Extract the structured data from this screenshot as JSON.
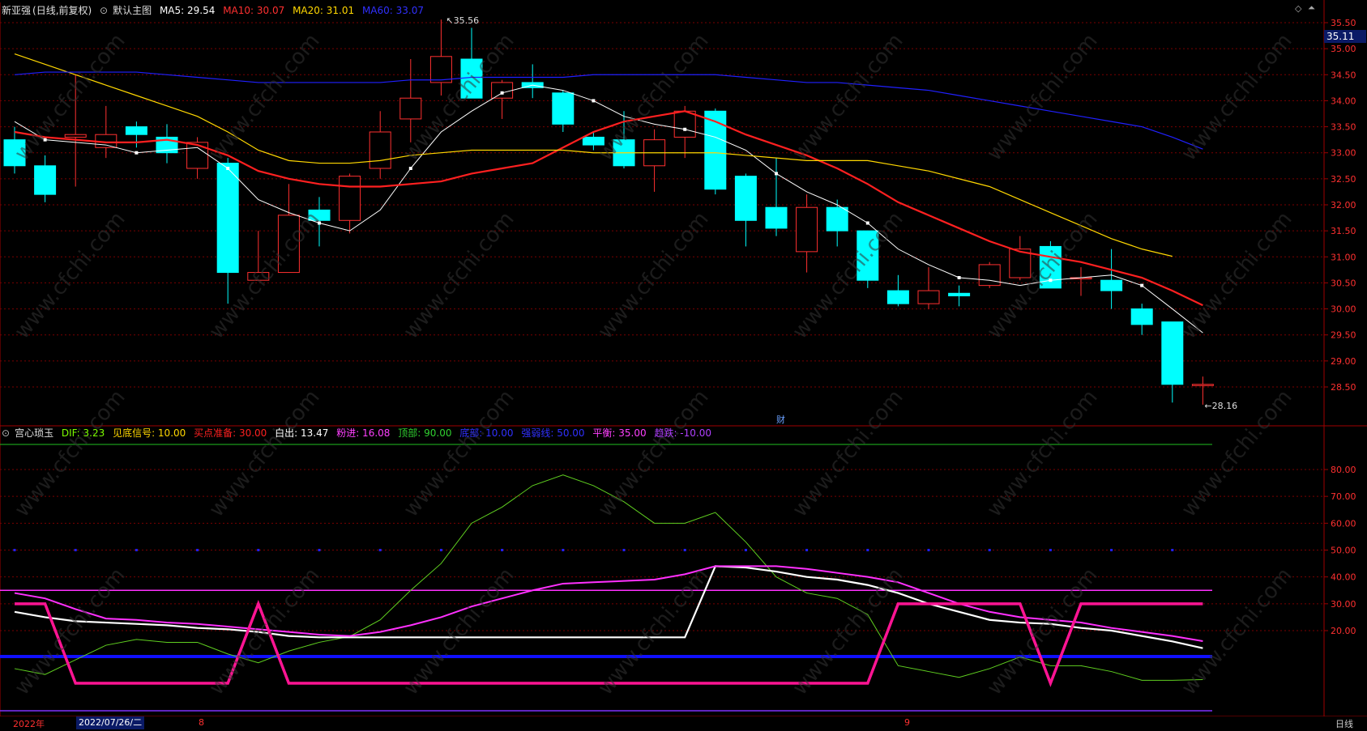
{
  "main_header": {
    "stock_name": "新亚强",
    "mode": "(日线,前复权)",
    "view_label": "默认主图",
    "ma5": "MA5: 29.54",
    "ma10": "MA10: 30.07",
    "ma20": "MA20: 31.01",
    "ma60": "MA60: 33.07"
  },
  "sub_header": {
    "indicator": "宫心琐玉",
    "dif": "DIF: 3.23",
    "signal": "见底信号: 10.00",
    "buy_prep": "买点准备: 30.00",
    "white_out": "白出: 13.47",
    "pink_in": "粉进: 16.08",
    "top": "顶部: 90.00",
    "bottom": "底部: 10.00",
    "strong_weak": "强弱线: 50.00",
    "balance": "平衡: 35.00",
    "fall": "趋跌: -10.00"
  },
  "price_axis_labels": [
    "35.50",
    "35.00",
    "34.50",
    "34.00",
    "33.50",
    "33.00",
    "32.50",
    "32.00",
    "31.50",
    "31.00",
    "30.50",
    "30.00",
    "29.50",
    "29.00",
    "28.50"
  ],
  "current_price_tag": "35.11",
  "sub_axis_labels": [
    "80.00",
    "70.00",
    "60.00",
    "50.00",
    "40.00",
    "30.00",
    "20.00"
  ],
  "high_label": "35.56",
  "low_label": "28.16",
  "finance_marker": "财",
  "date_bar": {
    "year": "2022年",
    "cursor_date": "2022/07/26/二",
    "month_aug": "8",
    "month_sep": "9",
    "period": "日线"
  },
  "colors": {
    "up": "#ff3030",
    "down": "#00ffff",
    "ma5": "#ffffff",
    "ma10": "#ff2020",
    "ma20": "#ffd700",
    "ma60": "#2020ff",
    "grid": "#7a0000"
  },
  "chart_data": [
    {
      "type": "candlestick",
      "title": "新亚强 (日线,前复权)",
      "ylim": [
        28.0,
        35.6
      ],
      "candles": [
        {
          "o": 33.25,
          "c": 32.75,
          "h": 33.5,
          "l": 32.6
        },
        {
          "o": 32.75,
          "c": 32.2,
          "h": 32.95,
          "l": 32.05
        },
        {
          "o": 33.3,
          "c": 33.35,
          "h": 34.5,
          "l": 32.35
        },
        {
          "o": 33.1,
          "c": 33.35,
          "h": 33.9,
          "l": 32.9
        },
        {
          "o": 33.5,
          "c": 33.35,
          "h": 33.6,
          "l": 33.1
        },
        {
          "o": 33.3,
          "c": 33.0,
          "h": 33.55,
          "l": 32.8
        },
        {
          "o": 32.7,
          "c": 33.2,
          "h": 33.3,
          "l": 32.5
        },
        {
          "o": 32.8,
          "c": 30.7,
          "h": 32.9,
          "l": 30.1
        },
        {
          "o": 30.55,
          "c": 30.7,
          "h": 31.5,
          "l": 30.55
        },
        {
          "o": 30.7,
          "c": 31.8,
          "h": 32.4,
          "l": 30.7
        },
        {
          "o": 31.9,
          "c": 31.7,
          "h": 32.15,
          "l": 31.2
        },
        {
          "o": 31.7,
          "c": 32.55,
          "h": 32.6,
          "l": 31.45
        },
        {
          "o": 32.7,
          "c": 33.4,
          "h": 33.8,
          "l": 32.5
        },
        {
          "o": 33.65,
          "c": 34.05,
          "h": 34.8,
          "l": 33.2
        },
        {
          "o": 34.35,
          "c": 34.85,
          "h": 35.56,
          "l": 34.1
        },
        {
          "o": 34.8,
          "c": 34.05,
          "h": 35.4,
          "l": 34.05
        },
        {
          "o": 34.05,
          "c": 34.35,
          "h": 34.4,
          "l": 33.65
        },
        {
          "o": 34.35,
          "c": 34.25,
          "h": 34.7,
          "l": 34.05
        },
        {
          "o": 34.15,
          "c": 33.55,
          "h": 34.2,
          "l": 33.4
        },
        {
          "o": 33.3,
          "c": 33.15,
          "h": 33.4,
          "l": 33.05
        },
        {
          "o": 33.25,
          "c": 32.75,
          "h": 33.8,
          "l": 32.7
        },
        {
          "o": 32.75,
          "c": 33.25,
          "h": 33.45,
          "l": 32.25
        },
        {
          "o": 33.3,
          "c": 33.8,
          "h": 33.9,
          "l": 32.9
        },
        {
          "o": 33.8,
          "c": 32.3,
          "h": 33.85,
          "l": 32.2
        },
        {
          "o": 32.55,
          "c": 31.7,
          "h": 32.6,
          "l": 31.2
        },
        {
          "o": 31.95,
          "c": 31.55,
          "h": 32.9,
          "l": 31.4
        },
        {
          "o": 31.1,
          "c": 31.95,
          "h": 32.2,
          "l": 30.7
        },
        {
          "o": 31.95,
          "c": 31.5,
          "h": 32.1,
          "l": 31.2
        },
        {
          "o": 31.5,
          "c": 30.55,
          "h": 31.5,
          "l": 30.4
        },
        {
          "o": 30.35,
          "c": 30.1,
          "h": 30.65,
          "l": 30.05
        },
        {
          "o": 30.1,
          "c": 30.35,
          "h": 30.8,
          "l": 30.0
        },
        {
          "o": 30.3,
          "c": 30.25,
          "h": 30.45,
          "l": 30.05
        },
        {
          "o": 30.45,
          "c": 30.85,
          "h": 30.9,
          "l": 30.4
        },
        {
          "o": 30.6,
          "c": 31.15,
          "h": 31.4,
          "l": 30.55
        },
        {
          "o": 31.2,
          "c": 30.4,
          "h": 31.3,
          "l": 30.4
        },
        {
          "o": 30.6,
          "c": 30.6,
          "h": 30.8,
          "l": 30.25
        },
        {
          "o": 30.55,
          "c": 30.35,
          "h": 31.15,
          "l": 30.0
        },
        {
          "o": 30.0,
          "c": 29.7,
          "h": 30.1,
          "l": 29.5
        },
        {
          "o": 29.75,
          "c": 28.55,
          "h": 29.75,
          "l": 28.2
        },
        {
          "o": 28.55,
          "c": 28.55,
          "h": 28.7,
          "l": 28.16
        }
      ],
      "series": [
        {
          "name": "MA5",
          "values": [
            33.6,
            33.25,
            33.2,
            33.15,
            33.0,
            33.05,
            33.1,
            32.7,
            32.1,
            31.85,
            31.65,
            31.5,
            31.9,
            32.7,
            33.4,
            33.8,
            34.15,
            34.3,
            34.2,
            34.0,
            33.7,
            33.55,
            33.45,
            33.3,
            33.05,
            32.6,
            32.25,
            32.0,
            31.65,
            31.15,
            30.85,
            30.6,
            30.55,
            30.45,
            30.55,
            30.6,
            30.65,
            30.45,
            30.0,
            29.54
          ]
        },
        {
          "name": "MA10",
          "values": [
            33.4,
            33.3,
            33.25,
            33.2,
            33.2,
            33.25,
            33.15,
            32.95,
            32.65,
            32.5,
            32.4,
            32.35,
            32.35,
            32.4,
            32.45,
            32.6,
            32.7,
            32.8,
            33.1,
            33.4,
            33.6,
            33.7,
            33.8,
            33.6,
            33.35,
            33.15,
            32.95,
            32.7,
            32.4,
            32.05,
            31.8,
            31.55,
            31.3,
            31.1,
            31.0,
            30.9,
            30.75,
            30.6,
            30.35,
            30.07
          ]
        },
        {
          "name": "MA20",
          "values": [
            34.9,
            34.7,
            34.5,
            34.3,
            34.1,
            33.9,
            33.7,
            33.4,
            33.05,
            32.85,
            32.8,
            32.8,
            32.85,
            32.95,
            33.0,
            33.05,
            33.05,
            33.05,
            33.05,
            33.0,
            33.0,
            33.0,
            33.0,
            33.0,
            32.95,
            32.9,
            32.85,
            32.85,
            32.85,
            32.75,
            32.65,
            32.5,
            32.35,
            32.1,
            31.85,
            31.6,
            31.35,
            31.15,
            31.01
          ]
        },
        {
          "name": "MA60",
          "values": [
            34.5,
            34.55,
            34.55,
            34.55,
            34.55,
            34.5,
            34.45,
            34.4,
            34.35,
            34.35,
            34.35,
            34.35,
            34.35,
            34.4,
            34.4,
            34.45,
            34.45,
            34.45,
            34.45,
            34.5,
            34.5,
            34.5,
            34.5,
            34.5,
            34.45,
            34.4,
            34.35,
            34.35,
            34.3,
            34.25,
            34.2,
            34.1,
            34.0,
            33.9,
            33.8,
            33.7,
            33.6,
            33.5,
            33.3,
            33.07
          ]
        }
      ]
    },
    {
      "type": "line",
      "title": "宫心琐玉",
      "ylim": [
        0,
        90
      ],
      "series": [
        {
          "name": "DIF",
          "values": [
            7,
            5,
            10,
            15,
            17,
            16,
            16,
            12,
            9,
            13,
            16,
            18,
            24,
            35,
            45,
            60,
            66,
            74,
            78,
            74,
            68,
            60,
            60,
            64,
            53,
            40,
            34,
            32,
            26,
            8,
            6,
            4,
            7,
            11,
            8,
            8,
            6,
            3,
            3,
            3.23
          ]
        },
        {
          "name": "白出",
          "values": [
            27,
            25,
            23.5,
            23,
            22.5,
            22,
            21,
            20.5,
            19.5,
            18,
            17.5,
            17.5,
            17.5,
            17.5,
            17.5,
            17.5,
            17.5,
            17.5,
            17.5,
            17.5,
            17.5,
            17.5,
            17.5,
            44,
            43.5,
            42,
            40,
            39,
            37,
            34,
            30,
            27,
            24,
            23,
            22.5,
            21,
            20,
            18,
            16,
            13.47
          ]
        },
        {
          "name": "粉进",
          "values": [
            34,
            32,
            28,
            24.5,
            24,
            23,
            22.5,
            21.5,
            20.5,
            19.5,
            18.5,
            18,
            19.5,
            22,
            25,
            29,
            32,
            35,
            37.5,
            38,
            38.5,
            39,
            41,
            44,
            44,
            44,
            43,
            41.5,
            40,
            38,
            34,
            30,
            27,
            25,
            24,
            23,
            21,
            19.5,
            18,
            16.08
          ]
        },
        {
          "name": "买点准备",
          "values": [
            30,
            30,
            0,
            0,
            0,
            0,
            0,
            0,
            30,
            0,
            0,
            0,
            0,
            0,
            0,
            0,
            0,
            0,
            0,
            0,
            0,
            0,
            0,
            0,
            0,
            0,
            0,
            0,
            0,
            30,
            30,
            30,
            30,
            30,
            0,
            30,
            30,
            30,
            30,
            30
          ]
        }
      ],
      "reference_lines": {
        "top": 90,
        "balance": 35,
        "strong_weak": 50,
        "bottom": 10
      }
    }
  ]
}
